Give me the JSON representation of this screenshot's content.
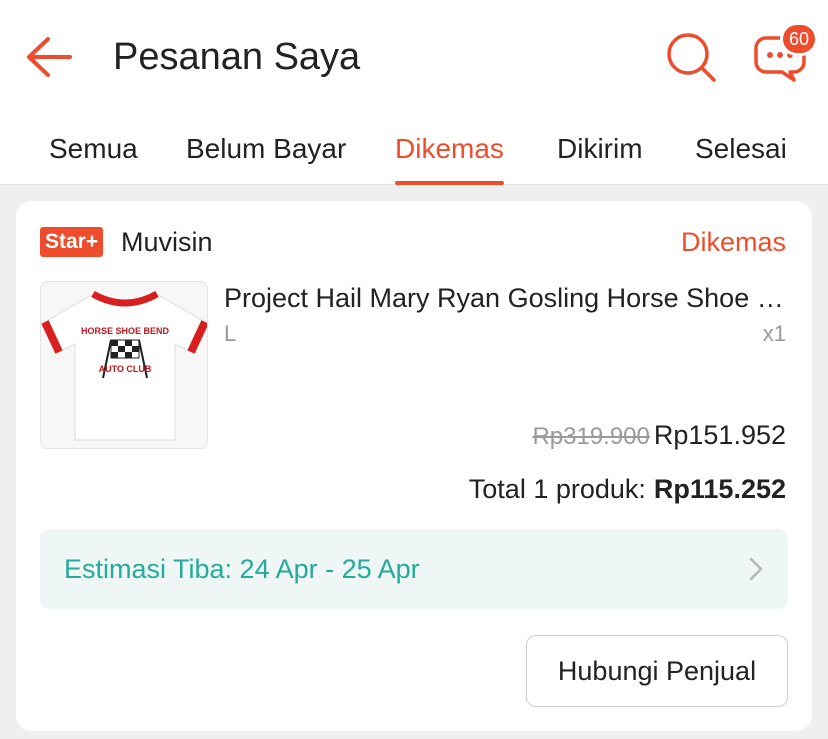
{
  "header": {
    "title": "Pesanan Saya",
    "chat_badge_count": "60",
    "accent_color": "#ee4d2d"
  },
  "tabs": [
    {
      "label": "Semua",
      "active": false
    },
    {
      "label": "Belum Bayar",
      "active": false
    },
    {
      "label": "Dikemas",
      "active": true
    },
    {
      "label": "Dikirim",
      "active": false
    },
    {
      "label": "Selesai",
      "active": false
    }
  ],
  "order": {
    "shop_badge": "Star+",
    "shop_name": "Muvisin",
    "status": "Dikemas",
    "product": {
      "name": "Project Hail Mary Ryan Gosling Horse Shoe Bend Auto Club T-Shirt",
      "variant": "L",
      "quantity": "x1",
      "original_price": "Rp319.900",
      "price": "Rp151.952",
      "image_text_top": "HORSE SHOE BEND",
      "image_text_bottom": "AUTO CLUB"
    },
    "total_label": "Total 1 produk:",
    "total_amount": "Rp115.252",
    "eta_text": "Estimasi Tiba: 24 Apr - 25 Apr",
    "contact_button": "Hubungi Penjual"
  },
  "colors": {
    "accent": "#ee4d2d",
    "eta_text": "#26aa99",
    "eta_bg": "#eef7f5"
  },
  "icons": [
    "arrow-left-icon",
    "search-icon",
    "chat-icon",
    "chevron-right-icon"
  ]
}
